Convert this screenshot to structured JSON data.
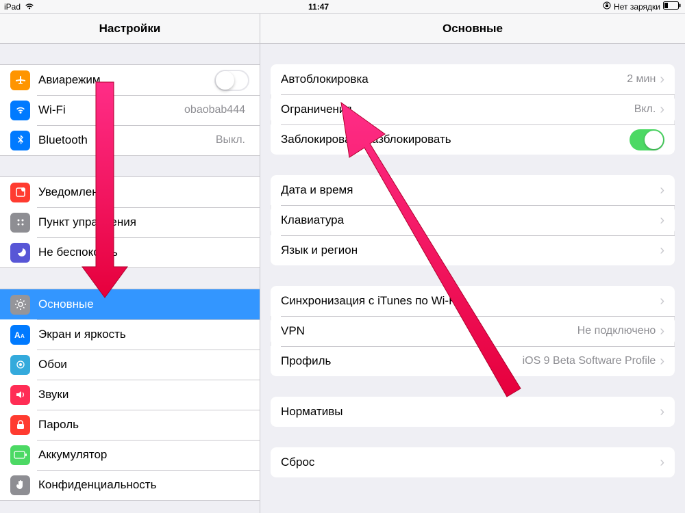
{
  "statusbar": {
    "device": "iPad",
    "time": "11:47",
    "charge_text": "Нет зарядки"
  },
  "sidebar": {
    "title": "Настройки",
    "groups": [
      {
        "rows": [
          {
            "key": "airplane",
            "icon": "airplane-icon",
            "icon_color": "ic-orange",
            "label": "Авиарежим",
            "control": "switch-off"
          },
          {
            "key": "wifi",
            "icon": "wifi-icon",
            "icon_color": "ic-blue",
            "label": "Wi-Fi",
            "value": "obaobab444"
          },
          {
            "key": "bluetooth",
            "icon": "bluetooth-icon",
            "icon_color": "ic-blue",
            "label": "Bluetooth",
            "value": "Выкл."
          }
        ]
      },
      {
        "rows": [
          {
            "key": "notifications",
            "icon": "notifications-icon",
            "icon_color": "ic-red",
            "label": "Уведомления"
          },
          {
            "key": "control-center",
            "icon": "control-center-icon",
            "icon_color": "ic-gray",
            "label": "Пункт управления"
          },
          {
            "key": "dnd",
            "icon": "moon-icon",
            "icon_color": "ic-purple",
            "label": "Не беспокоить"
          }
        ]
      },
      {
        "rows": [
          {
            "key": "general",
            "icon": "gear-icon",
            "icon_color": "ic-gray",
            "label": "Основные",
            "selected": true
          },
          {
            "key": "display",
            "icon": "text-size-icon",
            "icon_color": "ic-blue",
            "label": "Экран и яркость"
          },
          {
            "key": "wallpaper",
            "icon": "wallpaper-icon",
            "icon_color": "ic-cyan",
            "label": "Обои"
          },
          {
            "key": "sounds",
            "icon": "speaker-icon",
            "icon_color": "ic-redpnk",
            "label": "Звуки"
          },
          {
            "key": "passcode",
            "icon": "lock-icon",
            "icon_color": "ic-red",
            "label": "Пароль"
          },
          {
            "key": "battery",
            "icon": "battery-icon",
            "icon_color": "ic-green",
            "label": "Аккумулятор"
          },
          {
            "key": "privacy",
            "icon": "hand-icon",
            "icon_color": "ic-gray",
            "label": "Конфиденциальность"
          }
        ]
      }
    ]
  },
  "detail": {
    "title": "Основные",
    "groups": [
      {
        "rows": [
          {
            "key": "autolock",
            "label": "Автоблокировка",
            "value": "2 мин",
            "disclosure": true
          },
          {
            "key": "restrictions",
            "label": "Ограничения",
            "value": "Вкл.",
            "disclosure": true
          },
          {
            "key": "lockunlock",
            "label": "Заблокировать/разблокировать",
            "control": "switch-on"
          }
        ]
      },
      {
        "rows": [
          {
            "key": "datetime",
            "label": "Дата и время",
            "disclosure": true
          },
          {
            "key": "keyboard",
            "label": "Клавиатура",
            "disclosure": true
          },
          {
            "key": "language",
            "label": "Язык и регион",
            "disclosure": true
          }
        ]
      },
      {
        "rows": [
          {
            "key": "itunes-wifi",
            "label": "Синхронизация с iTunes по Wi-Fi",
            "disclosure": true
          },
          {
            "key": "vpn",
            "label": "VPN",
            "value": "Не подключено",
            "disclosure": true
          },
          {
            "key": "profile",
            "label": "Профиль",
            "value": "iOS 9 Beta Software Profile",
            "disclosure": true
          }
        ]
      },
      {
        "rows": [
          {
            "key": "regulatory",
            "label": "Нормативы",
            "disclosure": true
          }
        ]
      },
      {
        "rows": [
          {
            "key": "reset",
            "label": "Сброс",
            "disclosure": true
          }
        ]
      }
    ]
  }
}
